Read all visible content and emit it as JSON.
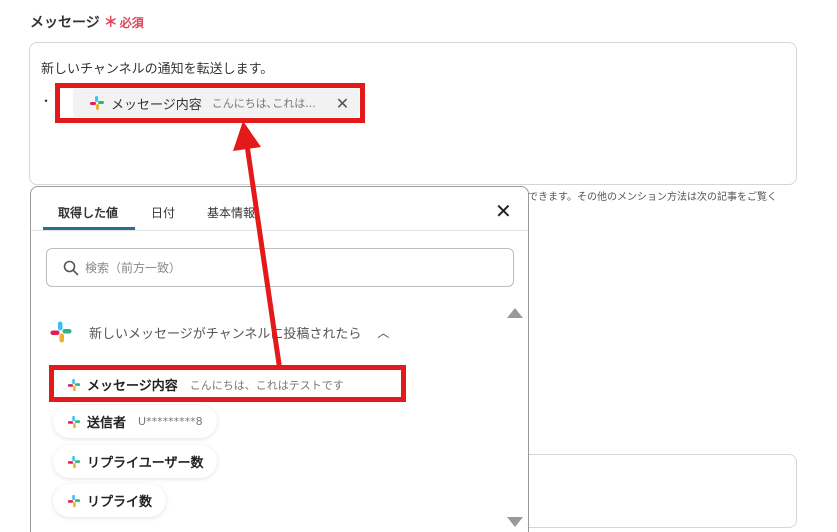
{
  "field": {
    "label": "メッセージ",
    "required_star": "＊",
    "required_text": "必須"
  },
  "editor": {
    "text": "新しいチャンネルの通知を転送します。",
    "bullet": "・",
    "chip_label": "メッセージ内容",
    "chip_preview": "こんにちは､これは...",
    "chip_close": "✕"
  },
  "hint": "できます。その他のメンション方法は次の記事をご覧く",
  "panel": {
    "tabs": [
      "取得した値",
      "日付",
      "基本情報"
    ],
    "close": "✕",
    "search_placeholder": "検索（前方一致）",
    "section_title": "新しいメッセージがチャンネルに投稿されたら",
    "section_chevron": "︿",
    "options": [
      {
        "label": "メッセージ内容",
        "preview": "こんにちは、これはテストです"
      },
      {
        "label": "送信者",
        "preview": "U*********8"
      },
      {
        "label": "リプライユーザー数",
        "preview": ""
      },
      {
        "label": "リプライ数",
        "preview": ""
      }
    ]
  },
  "colors": {
    "accent": "#2a6f8f",
    "highlight": "#e41a1a",
    "required": "#e0445a"
  },
  "icons": [
    "slack-icon",
    "search-icon",
    "close-icon",
    "chevron-up-icon",
    "arrow"
  ]
}
